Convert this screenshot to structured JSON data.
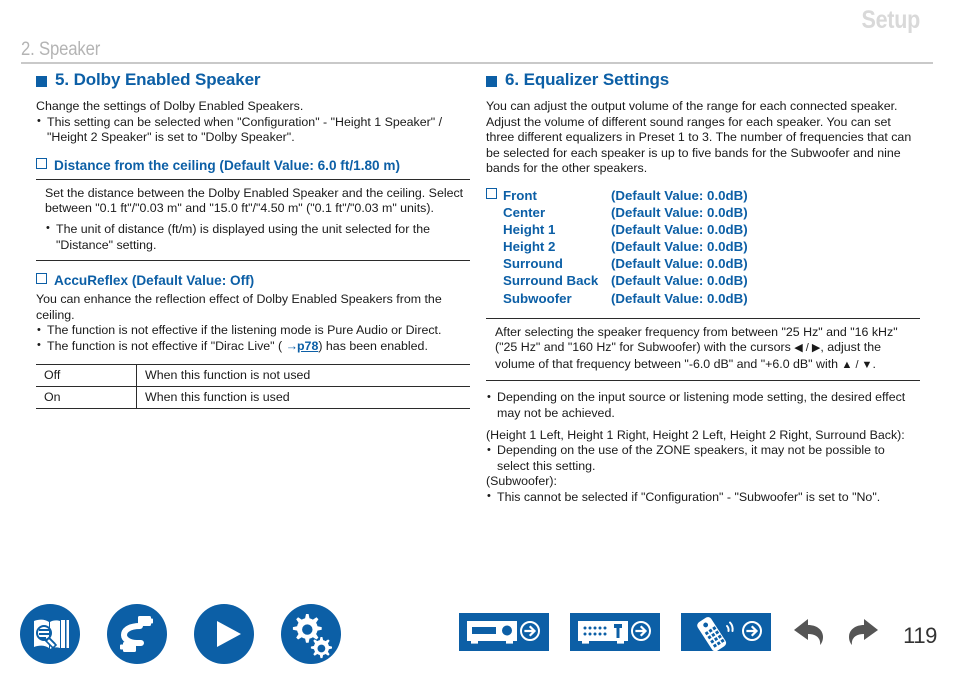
{
  "header": {
    "manual_section": "Setup",
    "chapter": "2. Speaker"
  },
  "left_column": {
    "heading": "5. Dolby Enabled Speaker",
    "intro": "Change the settings of Dolby Enabled Speakers.",
    "intro_bullets": [
      "This setting can be selected when \"Configuration\" - \"Height 1 Speaker\" / \"Height 2 Speaker\" is set to \"Dolby Speaker\"."
    ],
    "distance": {
      "sub_heading": "Distance from the ceiling (Default Value: 6.0 ft/1.80 m)",
      "note": "Set the distance between the Dolby Enabled Speaker and the ceiling. Select between \"0.1 ft\"/\"0.03 m\" and \"15.0 ft\"/\"4.50 m\" (\"0.1 ft\"/\"0.03 m\" units).",
      "note_bullets": [
        "The unit of distance (ft/m) is displayed using the unit selected for the \"Distance\" setting."
      ]
    },
    "accureflex": {
      "sub_heading": "AccuReflex (Default Value: Off)",
      "body": "You can enhance the reflection effect of Dolby Enabled Speakers from the ceiling.",
      "bullets_pre": "The function is not effective if the listening mode is Pure Audio or Direct.",
      "bullet_link_pre": "The function is not effective if \"Dirac Live\" ( ",
      "bullet_link_label": "p78",
      "bullet_link_post": ") has been enabled.",
      "table": {
        "rows": [
          {
            "option": "Off",
            "description": "When this function is not used"
          },
          {
            "option": "On",
            "description": "When this function is used"
          }
        ]
      }
    }
  },
  "right_column": {
    "heading": "6. Equalizer Settings",
    "intro": "You can adjust the output volume of the range for each connected speaker. Adjust the volume of different sound ranges for each speaker. You can set three different equalizers in Preset 1 to 3. The number of frequencies that can be selected for each speaker is up to five bands for the Subwoofer and nine bands for the other speakers.",
    "speakers": [
      {
        "name": "Front",
        "value": "(Default Value: 0.0dB)",
        "has_box": true
      },
      {
        "name": "Center",
        "value": "(Default Value: 0.0dB)",
        "has_box": false
      },
      {
        "name": "Height 1",
        "value": "(Default Value: 0.0dB)",
        "has_box": false
      },
      {
        "name": "Height 2",
        "value": "(Default Value: 0.0dB)",
        "has_box": false
      },
      {
        "name": "Surround",
        "value": "(Default Value: 0.0dB)",
        "has_box": false
      },
      {
        "name": "Surround Back",
        "value": "(Default Value: 0.0dB)",
        "has_box": false
      },
      {
        "name": "Subwoofer",
        "value": "(Default Value: 0.0dB)",
        "has_box": false
      }
    ],
    "note_part1": "After selecting the speaker frequency from between \"25 Hz\" and \"16 kHz\" (\"25 Hz\" and \"160 Hz\" for Subwoofer) with the cursors ",
    "note_cursor_lr": "◀ / ▶",
    "note_part2": ", adjust the volume of that frequency between \"-6.0 dB\" and \"+6.0 dB\" with ",
    "note_cursor_ud": "▲ / ▼",
    "note_part3": ".",
    "bullet_after_note": "Depending on the input source or listening mode setting, the desired effect may not be achieved.",
    "group_zone_label": "(Height 1 Left, Height 1 Right, Height 2 Left, Height 2 Right, Surround Back):",
    "group_zone_bullet": "Depending on the use of the ZONE speakers, it may not be possible to select this setting.",
    "group_sub_label": "(Subwoofer):",
    "group_sub_bullet": "This cannot be selected if \"Configuration\" - \"Subwoofer\" is set to \"No\"."
  },
  "footer": {
    "circle_icons": [
      "manual-search-icon",
      "connections-cable-icon",
      "play-icon",
      "setup-gears-icon"
    ],
    "rect_icons": [
      "front-panel-icon",
      "rear-panel-icon",
      "remote-control-icon"
    ],
    "nav": [
      "back-arrow-icon",
      "forward-arrow-icon"
    ],
    "page_number": "119"
  },
  "colors": {
    "brand_blue": "#0c5fa6",
    "header_gray": "#b4b4b4",
    "setup_gray": "#d9d9d9",
    "rule_gray": "#c9c9c9",
    "nav_arrow_gray": "#555555"
  }
}
